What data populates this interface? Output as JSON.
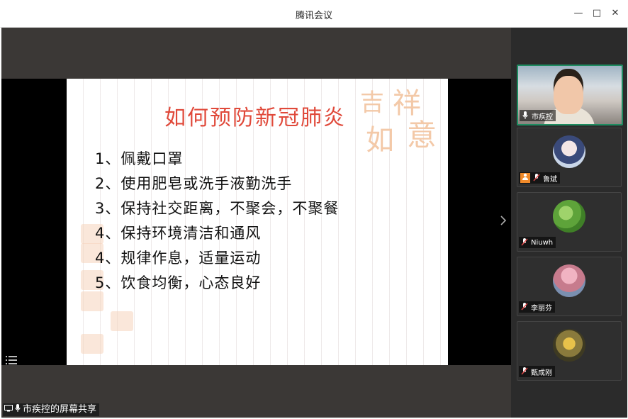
{
  "window": {
    "title": "腾讯会议",
    "controls": {
      "minimize": "—",
      "maximize": "□",
      "close": "✕"
    }
  },
  "slide": {
    "title": "如何预防新冠肺炎",
    "items": [
      "1、佩戴口罩",
      "2、使用肥皂或洗手液勤洗手",
      "3、保持社交距离，不聚会，不聚餐",
      "4、保持环境清洁和通风",
      "4、规律作息，适量运动",
      "5、饮食均衡，心态良好"
    ],
    "seal_text": [
      "吉",
      "祥",
      "如",
      "意"
    ]
  },
  "share_label": "市疾控的屏幕共享",
  "participants": [
    {
      "name": "市疾控",
      "type": "video",
      "active": true
    },
    {
      "name": "鲁斌",
      "type": "avatar",
      "host_badge": true,
      "avatar_color": "#c9d6e8"
    },
    {
      "name": "Niuwh",
      "type": "avatar",
      "avatar_color": "#6fb34a"
    },
    {
      "name": "李丽芬",
      "type": "avatar",
      "avatar_color": "#c77b8d"
    },
    {
      "name": "甄成刚",
      "type": "avatar",
      "avatar_color": "#8a7a3c"
    }
  ],
  "icons": {
    "mic": "mic-icon",
    "mic_muted": "mic-muted-icon",
    "list": "list-icon",
    "expand": "chevron-right-icon"
  },
  "colors": {
    "accent_green": "#1e8c61",
    "slide_title": "#e0493a",
    "host_badge": "#f08a2a"
  }
}
